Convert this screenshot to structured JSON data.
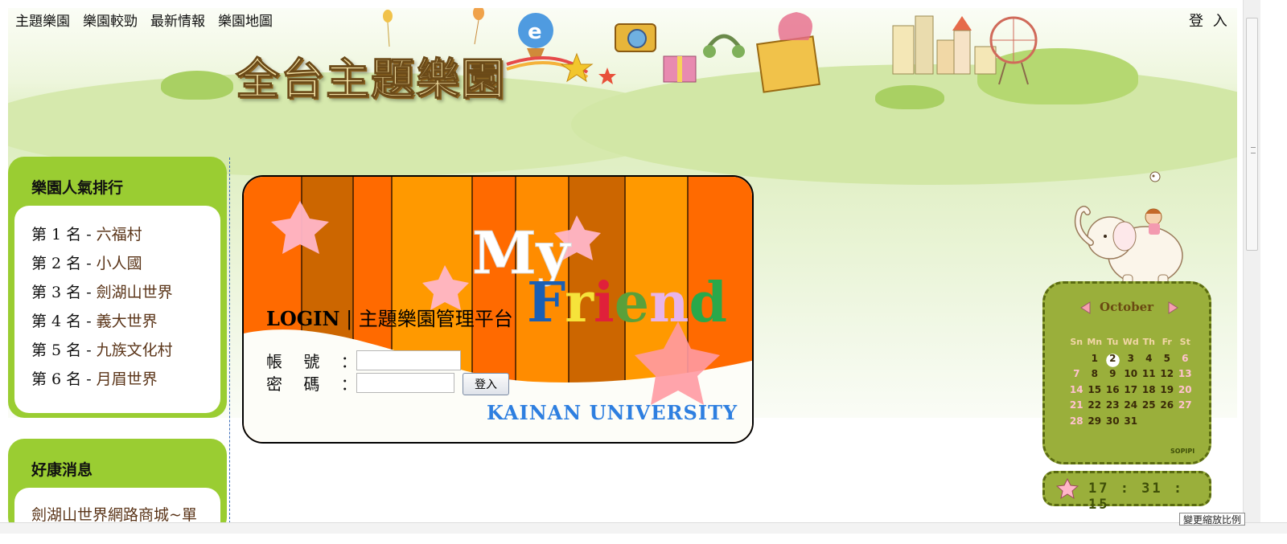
{
  "nav": {
    "items": [
      {
        "label": "主題樂園"
      },
      {
        "label": "樂園較勁"
      },
      {
        "label": "最新情報"
      },
      {
        "label": "樂園地圖"
      }
    ],
    "login": "登 入"
  },
  "banner": {
    "title": "全台主題樂園"
  },
  "sidebar": {
    "ranking": {
      "title": "樂園人氣排行",
      "items": [
        {
          "rank": "第 1 名 - ",
          "name": "六福村"
        },
        {
          "rank": "第 2 名 - ",
          "name": "小人國"
        },
        {
          "rank": "第 3 名 - ",
          "name": "劍湖山世界"
        },
        {
          "rank": "第 4 名 - ",
          "name": "義大世界"
        },
        {
          "rank": "第 5 名 - ",
          "name": "九族文化村"
        },
        {
          "rank": "第 6 名 - ",
          "name": "月眉世界"
        }
      ]
    },
    "deals": {
      "title": "好康消息",
      "items": [
        {
          "label": "劍湖山世界網路商城~單"
        }
      ]
    }
  },
  "login": {
    "heading_bold": "LOGIN",
    "heading_rest": " | 主題樂園管理平台",
    "account_label": "帳 號 ：",
    "password_label": "密 碼 ：",
    "account_value": "",
    "password_value": "",
    "submit_label": "登入",
    "banner_text_my": "My",
    "banner_text_friend": "Friend",
    "university": "KAINAN UNIVERSITY"
  },
  "calendar": {
    "month": "October",
    "weekdays": [
      "Sn",
      "Mn",
      "Tu",
      "Wd",
      "Th",
      "Fr",
      "St"
    ],
    "start_offset": 1,
    "days_in_month": 31,
    "today": 2,
    "brand": "SOPIPI"
  },
  "clock": {
    "time": "17 : 31 : 15"
  },
  "status": {
    "zoom_label": "變更縮放比例"
  },
  "colors": {
    "sidebar_green": "#9acd32",
    "widget_green": "#9aaf3b",
    "link_brown": "#5a3418",
    "university_blue": "#2e7fe0"
  }
}
